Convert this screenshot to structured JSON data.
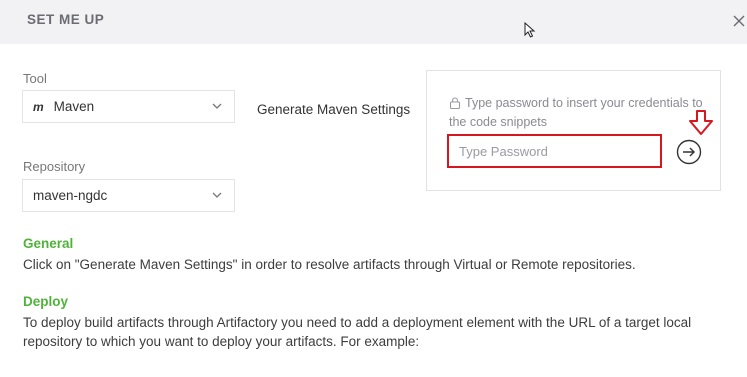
{
  "header": {
    "title": "SET ME UP"
  },
  "tool": {
    "label": "Tool",
    "selected": "Maven",
    "logo": "m"
  },
  "repository": {
    "label": "Repository",
    "selected": "maven-ngdc"
  },
  "generate_link": "Generate Maven Settings",
  "password": {
    "hint": "Type password to insert your credentials to the code snippets",
    "placeholder": "Type Password"
  },
  "sections": {
    "general": {
      "title": "General",
      "text": "Click on \"Generate Maven Settings\" in order to resolve artifacts through Virtual or Remote repositories."
    },
    "deploy": {
      "title": "Deploy",
      "text": "To deploy build artifacts through Artifactory you need to add a deployment element with the URL of a target local repository to which you want to deploy your artifacts. For example:"
    }
  },
  "colors": {
    "highlight": "#d6171d",
    "section_heading": "#4fb33a"
  }
}
